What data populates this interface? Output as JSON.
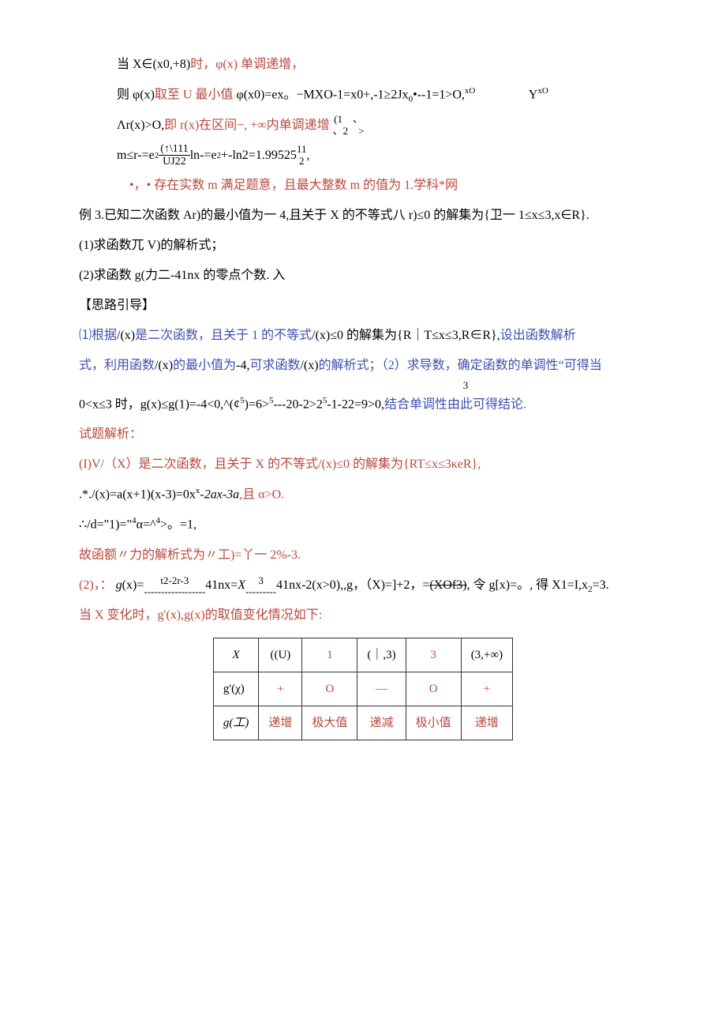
{
  "p1": {
    "a": "当 X∈(x0,+8)",
    "b": "时，φ(x)",
    "c": "单调递增，"
  },
  "p2": {
    "a": "则 φ(x)",
    "b": "取至 U 最小值",
    "c": " φ(x0)=ex。−MXO-1=x0+,-1≥2Jx",
    "d": "0",
    "e": "•--1=1>O,",
    "f": "xO",
    "g": "Y",
    "h": "xO"
  },
  "p3": {
    "a": "Λr(x)>O,",
    "b": "即 r(x)",
    "c": "在区间−, +∞内单调递增",
    "topL": "(1",
    "topR": "、",
    "botL": "、2",
    "botR": ">"
  },
  "p4": {
    "a": "m≤r-=e",
    "b": "2",
    "topMid": "(↑\\111",
    "botMid": "UJ22",
    "c": "ln-=e",
    "d": "2",
    "e": "+-ln2=1.99525",
    "top2": "11",
    "bot2": "2",
    "trail": ","
  },
  "p5": {
    "a": "•，• 存在实数 m 满足题意，且最大整数 m 的值为 1.",
    "b": "学科*网"
  },
  "p6": "例 3.已知二次函数 Ar)的最小值为一 4,且关于 X 的不等式八 r)≤0 的解集为{卫一 1≤x≤3,x∈R}.",
  "p7": "(1)求函数兀 V)的解析式；",
  "p8": "(2)求函数 g(力二-41nx 的零点个数. 入",
  "p9": "【思路引导】",
  "p10": {
    "a": "⑴根据",
    "b": "/(x)",
    "c": "是二次函数，且关于 1 的不等式",
    "d": "/(x)≤0 的解集为{R｜T≤x≤3,R∈R},",
    "e": "设出函数解析"
  },
  "p11": {
    "a": "式，利用函数",
    "b": "/(x)",
    "c": "的最小值为",
    "d": "-4,",
    "e": "可求函数",
    "f": "/(x)",
    "g": "的解析式；（2）求导数，确定函数的单调性“可得当"
  },
  "p12top": "3",
  "p12": {
    "a": "0<x≤3 时，g(x)≤g(1)=-4<0,^(¢",
    "b": "5",
    "c": ")=6>",
    "d": "5",
    "e": "---20-2>2",
    "f": "5",
    "g": "-1-22=9>0,",
    "h": "结合单调性由此可得结论."
  },
  "p13": "试题解析：",
  "p14": {
    "a": "(I)V/（X）是二次函数，且关于 X 的不等式",
    "b": "/(x)≤0 的解集为{RT≤x≤3κeR},"
  },
  "p15": {
    "a": ".*./(x)=a(x+1)(x-3)=0x",
    "b": "x",
    "c": "-2ax-3a",
    "d": ",且 α>O."
  },
  "p16": {
    "a": "∴/d=\"1)=\"",
    "b": "4",
    "c": "α=^",
    "d": "4",
    "e": ">。=1,"
  },
  "p17": "故函额〃力的解析式为〃工)=丫一 2%-3.",
  "p18": {
    "a": "(2)，：",
    "b": "g",
    "c": "(x)= ",
    "topFrac": "t2-2r-3",
    "dash1": "------------------",
    "d": "41nx=",
    "e": "X",
    "dash2": "---------",
    "top3": "3",
    "f": "41nx-2(x>0),,g，（X)=]+2，=",
    "strike": "(XOf3)",
    "g": ", 令 g[x)=。, 得 X1=I,x",
    "h": "2",
    "i": "=3."
  },
  "p19": {
    "a": "当 X 变化时，g'(x),g(x)",
    "b": "的取值变化情况如下:"
  },
  "table": {
    "r1": [
      "X",
      "((U)",
      "1",
      "(｜,3)",
      "3",
      "(3,+∞)"
    ],
    "r2": [
      "g'(χ)",
      "+",
      "O",
      "—",
      "O",
      "+"
    ],
    "r3": [
      "g(工)",
      "递增",
      "极大值",
      "递减",
      "极小值",
      "递增"
    ]
  }
}
